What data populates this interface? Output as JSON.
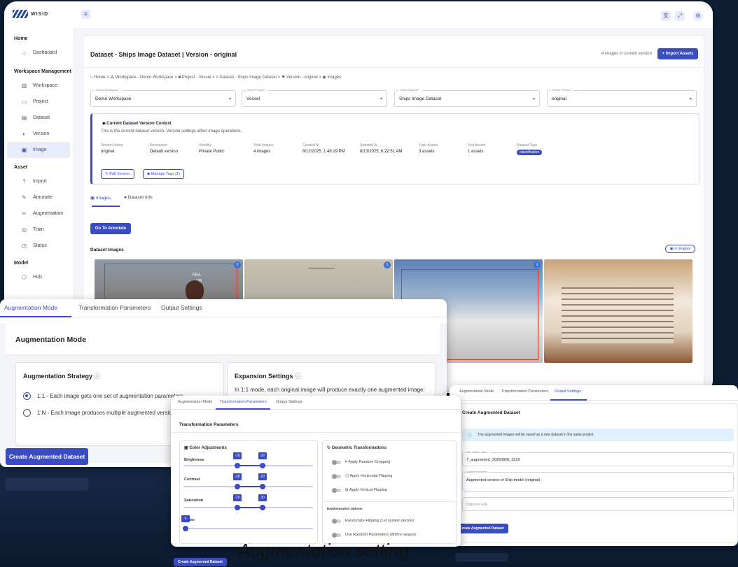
{
  "app": {
    "logo": "WISID"
  },
  "sidebar": {
    "sections": [
      {
        "title": "Home",
        "items": [
          {
            "label": "Dashboard",
            "icon": "home-icon"
          }
        ]
      },
      {
        "title": "Workspace Management",
        "items": [
          {
            "label": "Workspace"
          },
          {
            "label": "Project"
          },
          {
            "label": "Dataset"
          },
          {
            "label": "Version"
          },
          {
            "label": "Image"
          }
        ]
      },
      {
        "title": "Asset",
        "items": [
          {
            "label": "Import"
          },
          {
            "label": "Annotate"
          },
          {
            "label": "Augmentation"
          },
          {
            "label": "Train"
          },
          {
            "label": "Status"
          }
        ]
      },
      {
        "title": "Model",
        "items": [
          {
            "label": "Hub"
          }
        ]
      }
    ]
  },
  "page": {
    "title": "Dataset - Ships Image Dataset | Version - original",
    "image_count": "4 images in current version",
    "import_label": "+ Import Assets",
    "breadcrumb": "⌂ Home  >  ⁂ Workspace - Demo Workspace  >  ■ Project - Vessel  >  ≡ Dataset - Ships Image Dataset  >  ⚑ Version - original  >  ◉ Images",
    "selects": [
      {
        "label": "Select Workspace *",
        "value": "Demo Workspace"
      },
      {
        "label": "Select Project *",
        "value": "Vessel"
      },
      {
        "label": "Select Dataset *",
        "value": "Ships Image Dataset"
      },
      {
        "label": "Select Version *",
        "value": "original"
      }
    ],
    "context": {
      "heading": "Current Dataset Version Context",
      "desc": "This is the current dataset version. Version settings affect image operations.",
      "fields": [
        {
          "k": "Version Name",
          "v": "original"
        },
        {
          "k": "Description",
          "v": "Default version"
        },
        {
          "k": "Visibility",
          "v": "Private   Public"
        },
        {
          "k": "Total Images",
          "v": "4 images"
        },
        {
          "k": "Created At",
          "v": "8/12/2025, 1:48:19 PM"
        },
        {
          "k": "Updated At",
          "v": "8/13/2025, 6:22:51 AM"
        },
        {
          "k": "Train Assets",
          "v": "3 assets"
        },
        {
          "k": "Test Assets",
          "v": "1 assets"
        },
        {
          "k": "Dataset Tags",
          "v": "classification"
        }
      ],
      "edit_label": "Edit Version",
      "tags_label": "Manage Tags (1)"
    },
    "tabs": [
      "Images",
      "Dataset Info"
    ],
    "go_annotate": "Go To Annotate",
    "dataset_images": "Dataset Images",
    "images_badge": "4 Images",
    "thumb_badges": [
      "2",
      "1",
      "1",
      ""
    ],
    "thumb_text": [
      "FBA",
      "139"
    ]
  },
  "panel1": {
    "tabs": [
      "Augmentation Mode",
      "Transformation Parameters",
      "Output Settings"
    ],
    "heading": "Augmentation Mode",
    "strategy": "Augmentation Strategy",
    "opt1": "1:1 - Each image gets one set of augmentation parameters",
    "opt2": "1:N - Each image produces multiple augmented versio",
    "expansion": "Expansion Settings",
    "expansion_text": "In 1:1 mode, each original image will produce exactly one augmented image.",
    "create": "Create Augmented Dataset",
    "bg_create": "Create Augmented Dataset"
  },
  "panel2": {
    "tabs": [
      "Augmentation Mode",
      "Transformation Parameters",
      "Output Settings"
    ],
    "heading": "Transformation Parameters",
    "color": "Color Adjustments",
    "sliders": [
      {
        "label": "Brightness",
        "lo": "-20",
        "hi": "20"
      },
      {
        "label": "Contrast",
        "lo": "-20",
        "hi": "20"
      },
      {
        "label": "Saturation",
        "lo": "-20",
        "hi": "20"
      },
      {
        "label": "Noise",
        "val": "0"
      }
    ],
    "geo": "Geometric Transformations",
    "geo_opts": [
      "Apply Random Cropping",
      "Apply Horizontal Flipping",
      "Apply Vertical Flipping"
    ],
    "rand": "Randomization Options",
    "rand_opts": [
      "Randomize Flipping (Let system decide)",
      "Use Random Parameters (Within ranges)"
    ],
    "create": "Create Augmented Dataset"
  },
  "panel3": {
    "tabs": [
      "Augmentation Mode",
      "Transformation Parameters",
      "Output Settings"
    ],
    "heading": "Create Augmented Dataset",
    "info": "The augmented images will be saved as a new dataset in the same project.",
    "name_label": "New Dataset Name *",
    "name_value": "7_augmented_20250820_2219",
    "desc_label": "Dataset Description",
    "desc_value": "Augmented version of Ship model (original)",
    "url_placeholder": "Dataset URL",
    "create": "Create Augmented Dataset"
  },
  "caption": "Augmentation setting",
  "colors": {
    "accent": "#3b4cc0",
    "background": "#0e1f35"
  }
}
